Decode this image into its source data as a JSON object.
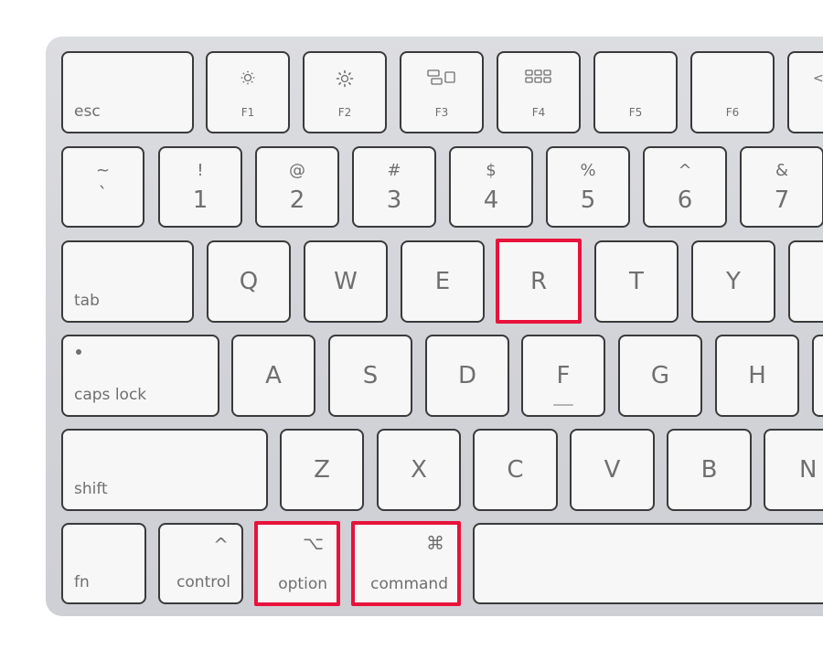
{
  "keyboard": {
    "highlight_color": "#e8123b",
    "highlighted_keys": [
      "R",
      "option",
      "command"
    ],
    "row_function": {
      "esc": "esc",
      "f1": "F1",
      "f2": "F2",
      "f3": "F3",
      "f4": "F4",
      "f5": "F5",
      "f6": "F6",
      "f7_partial_glyph": "<"
    },
    "row_number": [
      {
        "shift": "~",
        "base": "`"
      },
      {
        "shift": "!",
        "base": "1"
      },
      {
        "shift": "@",
        "base": "2"
      },
      {
        "shift": "#",
        "base": "3"
      },
      {
        "shift": "$",
        "base": "4"
      },
      {
        "shift": "%",
        "base": "5"
      },
      {
        "shift": "^",
        "base": "6"
      },
      {
        "shift": "&",
        "base": "7"
      }
    ],
    "row_qwerty": {
      "tab": "tab",
      "letters": [
        "Q",
        "W",
        "E",
        "R",
        "T",
        "Y"
      ]
    },
    "row_home": {
      "caps_lock": "caps lock",
      "letters": [
        "A",
        "S",
        "D",
        "F",
        "G",
        "H"
      ]
    },
    "row_shift": {
      "shift": "shift",
      "letters": [
        "Z",
        "X",
        "C",
        "V",
        "B",
        "N"
      ]
    },
    "row_bottom": {
      "fn": "fn",
      "control": "control",
      "control_symbol": "^",
      "option": "option",
      "option_symbol": "⌥",
      "command": "command",
      "command_symbol": "⌘"
    }
  }
}
